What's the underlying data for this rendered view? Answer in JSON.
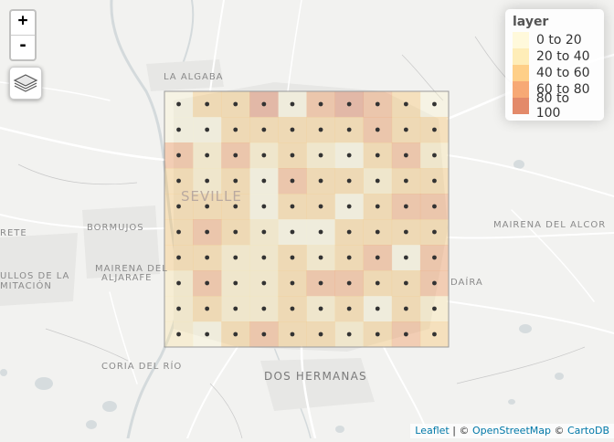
{
  "controls": {
    "zoom_in_label": "+",
    "zoom_out_label": "-"
  },
  "legend": {
    "title": "layer",
    "items": [
      {
        "label": "0 to 20",
        "color": "#fff7cc"
      },
      {
        "label": "20 to 40",
        "color": "#fee59a"
      },
      {
        "label": "40 to 60",
        "color": "#fdbb55"
      },
      {
        "label": "60 to 80",
        "color": "#f4843a"
      },
      {
        "label": "80 to 100",
        "color": "#d7582b"
      }
    ]
  },
  "places": [
    {
      "name": "LA ALGABA"
    },
    {
      "name": "SEVILLE"
    },
    {
      "name": "BORMUJOS"
    },
    {
      "name": "MAIRENA DEL ALCOR"
    },
    {
      "name": "MAIRENA DEL"
    },
    {
      "name": "ALJARAFE"
    },
    {
      "name": "ULLOS DE LA"
    },
    {
      "name": "MITACIÓN"
    },
    {
      "name": "RETE"
    },
    {
      "name": "DAÍRA"
    },
    {
      "name": "CORIA DEL RÍO"
    },
    {
      "name": "DOS HERMANAS"
    }
  ],
  "attribution": {
    "leaflet": "Leaflet",
    "sep1": " | © ",
    "osm": "OpenStreetMap",
    "sep2": " © ",
    "carto": "CartoDB"
  },
  "grid": {
    "rows": 10,
    "cols": 10,
    "values": [
      [
        8,
        45,
        58,
        80,
        10,
        70,
        85,
        68,
        55,
        5
      ],
      [
        9,
        12,
        52,
        46,
        56,
        50,
        55,
        62,
        44,
        58
      ],
      [
        66,
        30,
        60,
        20,
        54,
        24,
        18,
        40,
        75,
        30
      ],
      [
        45,
        30,
        50,
        15,
        72,
        55,
        52,
        20,
        58,
        45
      ],
      [
        48,
        52,
        42,
        18,
        40,
        48,
        8,
        50,
        62,
        60
      ],
      [
        42,
        65,
        55,
        38,
        15,
        10,
        44,
        52,
        58,
        52
      ],
      [
        58,
        50,
        22,
        28,
        58,
        24,
        50,
        65,
        10,
        75
      ],
      [
        22,
        66,
        30,
        35,
        54,
        74,
        60,
        50,
        56,
        70
      ],
      [
        24,
        48,
        32,
        28,
        50,
        35,
        54,
        8,
        50,
        20
      ],
      [
        25,
        12,
        45,
        78,
        58,
        58,
        38,
        54,
        74,
        56
      ]
    ]
  }
}
